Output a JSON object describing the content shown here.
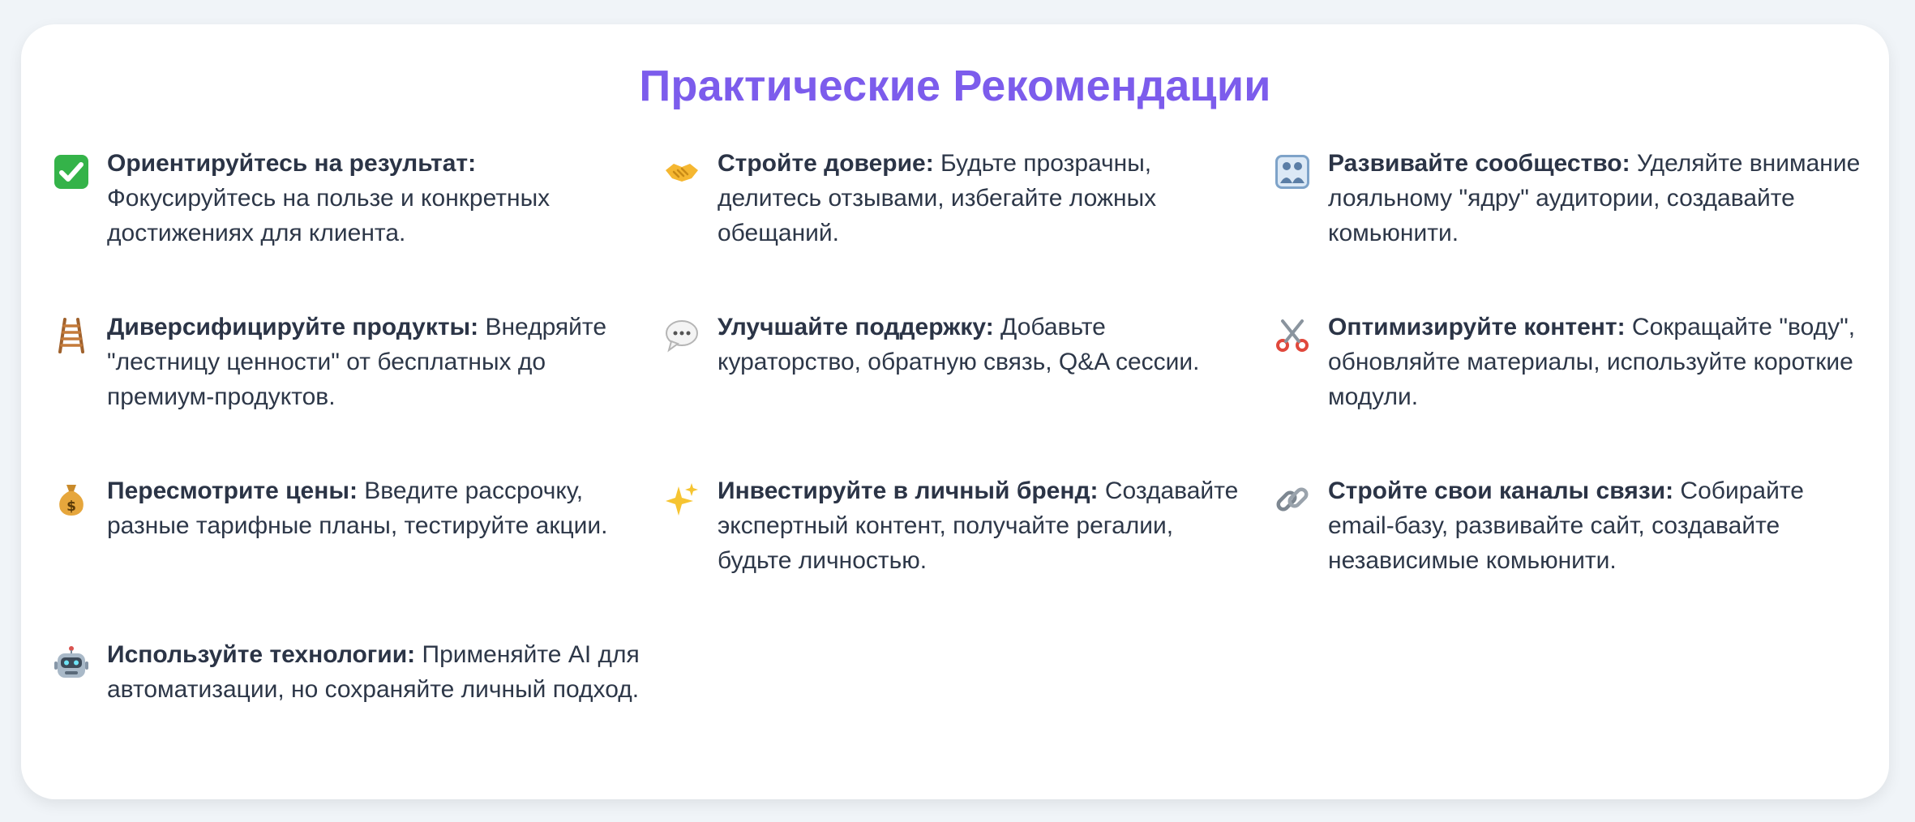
{
  "title": "Практические Рекомендации",
  "items": [
    {
      "icon": "check-mark-icon",
      "bold": "Ориентируйтесь на результат:",
      "text": " Фокусируйтесь на пользе и конкретных достижениях для клиента."
    },
    {
      "icon": "handshake-icon",
      "bold": "Стройте доверие:",
      "text": " Будьте прозрачны, делитесь отзывами, избегайте ложных обещаний."
    },
    {
      "icon": "community-icon",
      "bold": "Развивайте сообщество:",
      "text": " Уделяйте внимание лояльному \"ядру\" аудитории, создавайте комьюнити."
    },
    {
      "icon": "ladder-icon",
      "bold": "Диверсифицируйте продукты:",
      "text": " Внедряйте \"лестницу ценности\" от бесплатных до премиум-продуктов."
    },
    {
      "icon": "speech-bubble-icon",
      "bold": "Улучшайте поддержку:",
      "text": " Добавьте кураторство, обратную связь, Q&A сессии."
    },
    {
      "icon": "scissors-icon",
      "bold": "Оптимизируйте контент:",
      "text": " Сокращайте \"воду\", обновляйте материалы, используйте короткие модули."
    },
    {
      "icon": "money-bag-icon",
      "bold": "Пересмотрите цены:",
      "text": " Введите рассрочку, разные тарифные планы, тестируйте акции."
    },
    {
      "icon": "sparkles-icon",
      "bold": "Инвестируйте в личный бренд:",
      "text": " Создавайте экспертный контент, получайте регалии, будьте личностью."
    },
    {
      "icon": "link-icon",
      "bold": "Стройте свои каналы связи:",
      "text": " Собирайте email-базу, развивайте сайт, создавайте независимые комьюнити."
    },
    {
      "icon": "robot-icon",
      "bold": "Используйте технологии:",
      "text": " Применяйте AI для автоматизации, но сохраняйте личный подход."
    }
  ]
}
